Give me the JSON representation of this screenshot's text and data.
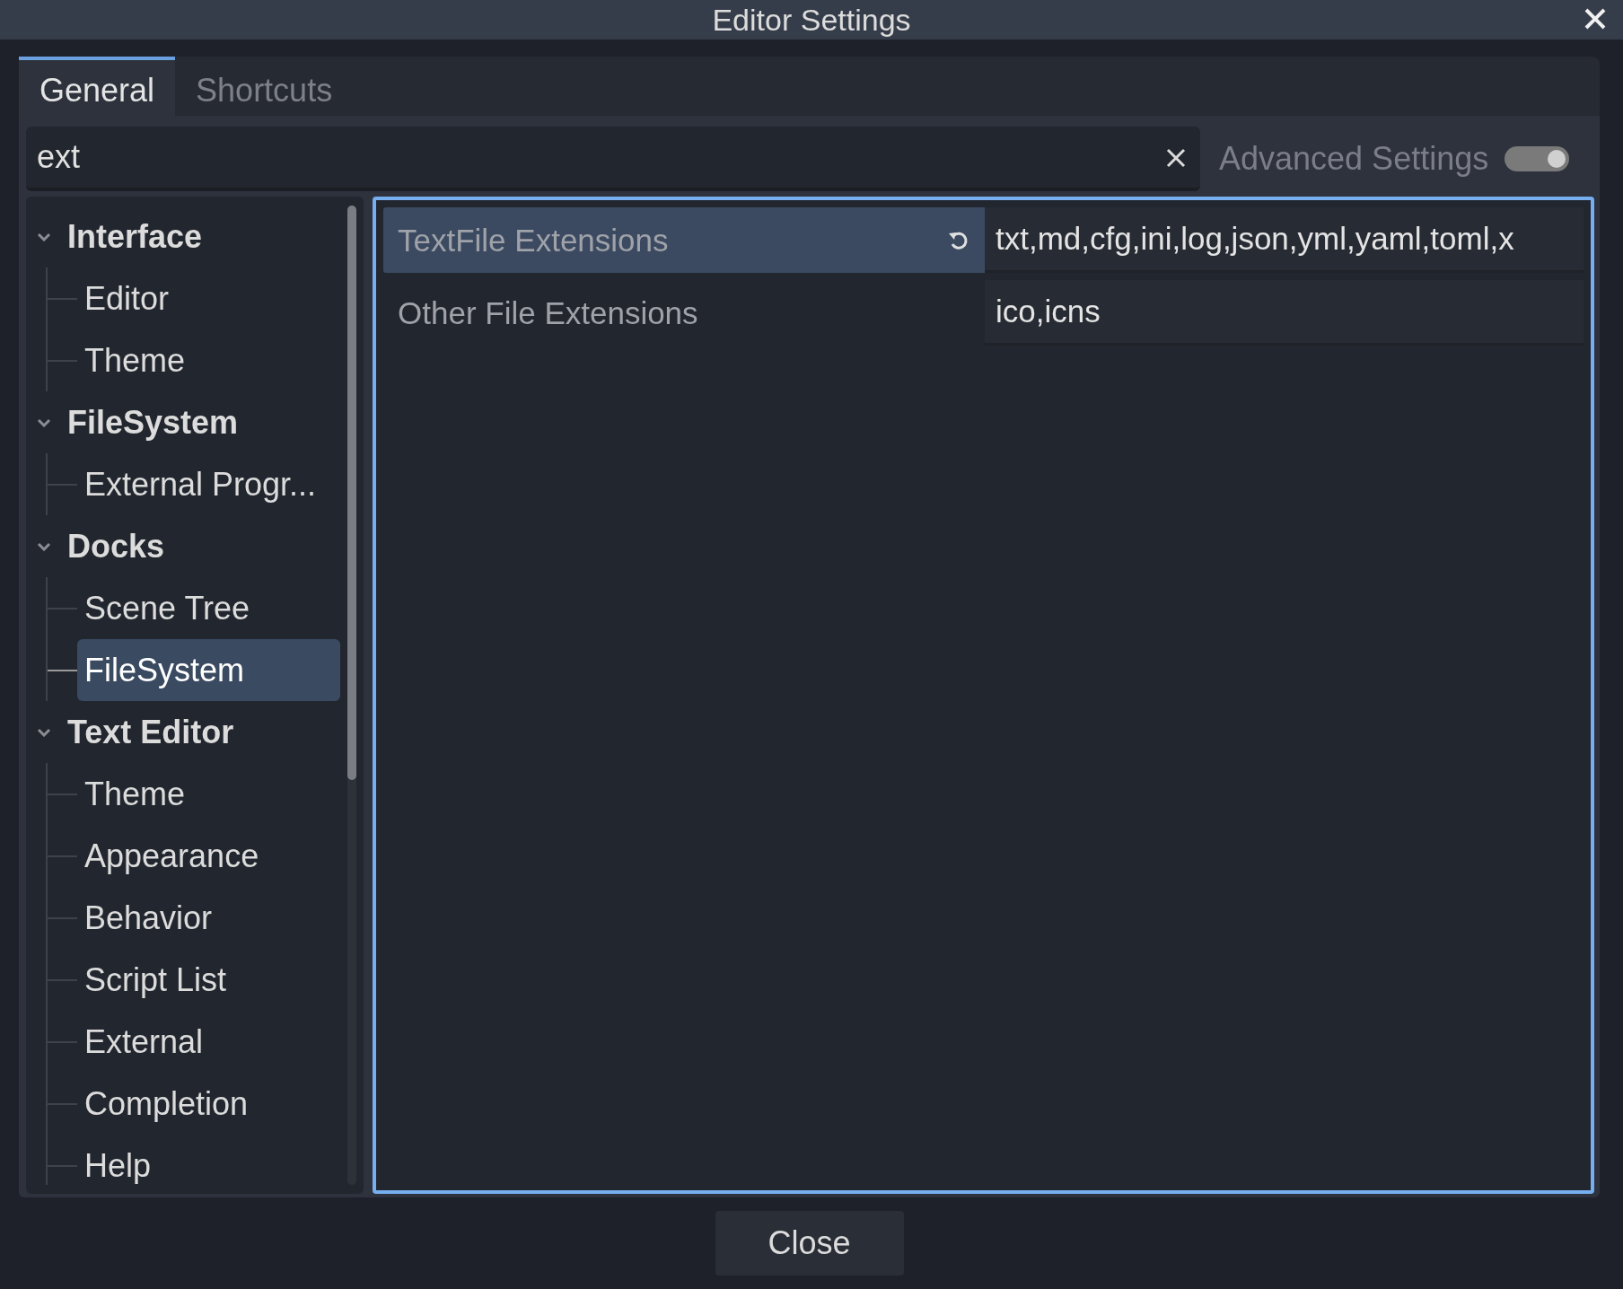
{
  "window": {
    "title": "Editor Settings"
  },
  "tabs": [
    {
      "label": "General",
      "selected": true
    },
    {
      "label": "Shortcuts",
      "selected": false
    }
  ],
  "search": {
    "value": "ext"
  },
  "advanced_settings": {
    "label": "Advanced Settings",
    "on": true,
    "disabled": true
  },
  "tree": [
    {
      "label": "Interface",
      "expanded": true,
      "children": [
        {
          "label": "Editor",
          "selected": false
        },
        {
          "label": "Theme",
          "selected": false
        }
      ]
    },
    {
      "label": "FileSystem",
      "expanded": true,
      "children": [
        {
          "label": "External Progr...",
          "selected": false
        }
      ]
    },
    {
      "label": "Docks",
      "expanded": true,
      "children": [
        {
          "label": "Scene Tree",
          "selected": false
        },
        {
          "label": "FileSystem",
          "selected": true
        }
      ]
    },
    {
      "label": "Text Editor",
      "expanded": true,
      "children": [
        {
          "label": "Theme",
          "selected": false
        },
        {
          "label": "Appearance",
          "selected": false
        },
        {
          "label": "Behavior",
          "selected": false
        },
        {
          "label": "Script List",
          "selected": false
        },
        {
          "label": "External",
          "selected": false
        },
        {
          "label": "Completion",
          "selected": false
        },
        {
          "label": "Help",
          "selected": false
        }
      ]
    }
  ],
  "properties": [
    {
      "label": "TextFile Extensions",
      "value": "txt,md,cfg,ini,log,json,yml,yaml,toml,x",
      "selected": true,
      "modified": true
    },
    {
      "label": "Other File Extensions",
      "value": "ico,icns",
      "selected": false,
      "modified": false
    }
  ],
  "close_button": "Close"
}
